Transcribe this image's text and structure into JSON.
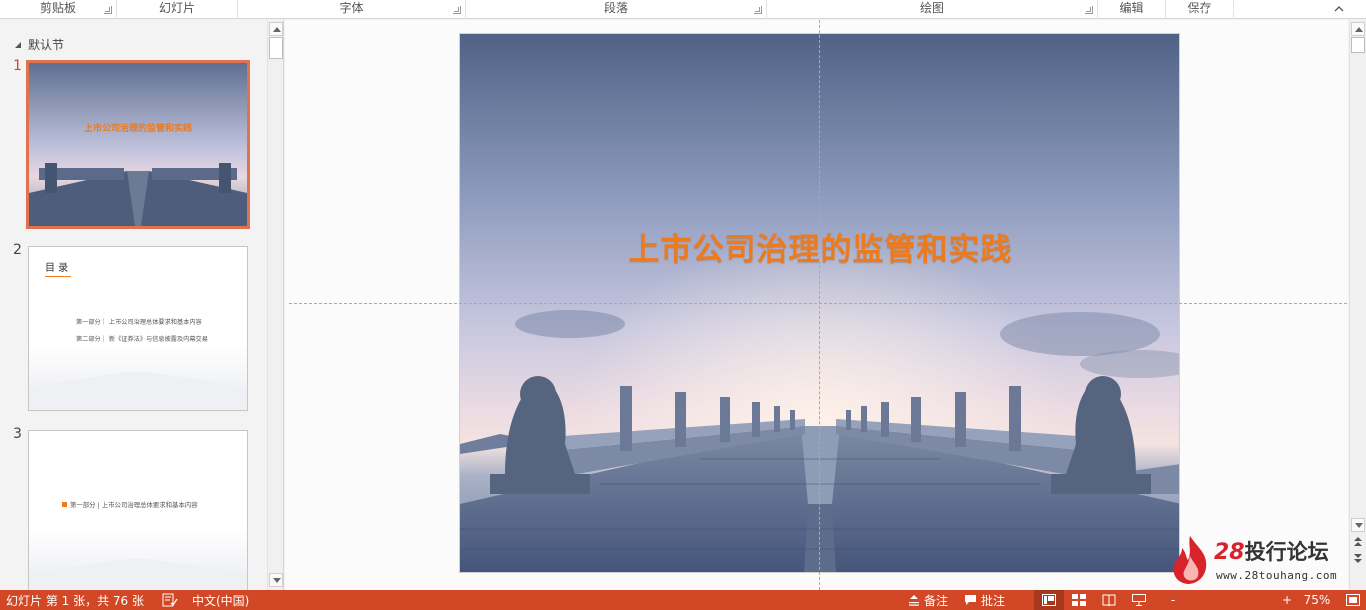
{
  "ribbon": {
    "groups": [
      {
        "label": "剪贴板",
        "launcher": true
      },
      {
        "label": "幻灯片",
        "launcher": false
      },
      {
        "label": "字体",
        "launcher": true
      },
      {
        "label": "段落",
        "launcher": true
      },
      {
        "label": "绘图",
        "launcher": true
      },
      {
        "label": "编辑",
        "launcher": false
      },
      {
        "label": "保存",
        "launcher": false
      }
    ]
  },
  "thumbnails": {
    "section_name": "默认节",
    "slides": [
      {
        "number": "1",
        "title": "上市公司治理的监管和实践",
        "selected": true
      },
      {
        "number": "2",
        "heading": "目 录",
        "lines": [
          "第一部分｜ 上市公司治理总体要求和基本内容",
          "第二部分｜ 新《证券法》与信息披露及内幕交易"
        ]
      },
      {
        "number": "3",
        "line": "第一部分 | 上市公司治理总体要求和基本内容"
      }
    ]
  },
  "slide": {
    "title": "上市公司治理的监管和实践",
    "title_color": "#ec7a1f"
  },
  "statusbar": {
    "slide_info": "幻灯片 第 1 张，共 76 张",
    "language": "中文(中国)",
    "notes_label": "备注",
    "comments_label": "批注",
    "zoom_minus": "-",
    "zoom_plus": "+",
    "zoom_level": "75%",
    "bg_color": "#d24726"
  },
  "watermark": {
    "brand_number": "28",
    "brand_text": "投行论坛",
    "url": "www.28touhang.com"
  }
}
